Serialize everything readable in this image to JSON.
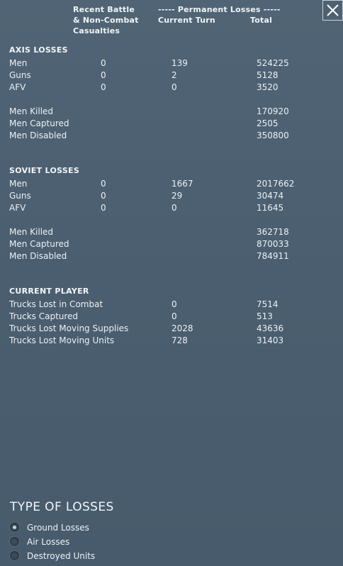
{
  "header": {
    "recent_line1": "Recent Battle",
    "recent_line2": "& Non-Combat",
    "recent_line3": "Casualties",
    "permanent": "----- Permanent Losses -----",
    "current_turn": "Current Turn",
    "total": "Total"
  },
  "axis": {
    "title": "AXIS LOSSES",
    "rows": [
      {
        "label": "Men",
        "recent": "0",
        "turn": "139",
        "total": "524225"
      },
      {
        "label": "Guns",
        "recent": "0",
        "turn": "2",
        "total": "5128"
      },
      {
        "label": "AFV",
        "recent": "0",
        "turn": "0",
        "total": "3520"
      }
    ],
    "detail": [
      {
        "label": "Men Killed",
        "total": "170920"
      },
      {
        "label": "Men Captured",
        "total": "2505"
      },
      {
        "label": "Men Disabled",
        "total": "350800"
      }
    ]
  },
  "soviet": {
    "title": "SOVIET LOSSES",
    "rows": [
      {
        "label": "Men",
        "recent": "0",
        "turn": "1667",
        "total": "2017662"
      },
      {
        "label": "Guns",
        "recent": "0",
        "turn": "29",
        "total": "30474"
      },
      {
        "label": "AFV",
        "recent": "0",
        "turn": "0",
        "total": "11645"
      }
    ],
    "detail": [
      {
        "label": "Men Killed",
        "total": "362718"
      },
      {
        "label": "Men Captured",
        "total": "870033"
      },
      {
        "label": "Men Disabled",
        "total": "784911"
      }
    ]
  },
  "player": {
    "title": "CURRENT PLAYER",
    "rows": [
      {
        "label": "Trucks Lost in Combat",
        "turn": "0",
        "total": "7514"
      },
      {
        "label": "Trucks Captured",
        "turn": "0",
        "total": "513"
      },
      {
        "label": "Trucks Lost Moving Supplies",
        "turn": "2028",
        "total": "43636"
      },
      {
        "label": "Trucks Lost Moving Units",
        "turn": "728",
        "total": "31403"
      }
    ]
  },
  "loss_type": {
    "title": "TYPE OF LOSSES",
    "options": [
      {
        "label": "Ground Losses",
        "selected": true
      },
      {
        "label": "Air Losses",
        "selected": false
      },
      {
        "label": "Destroyed Units",
        "selected": false
      }
    ]
  },
  "icons": {
    "close": "close-icon"
  }
}
